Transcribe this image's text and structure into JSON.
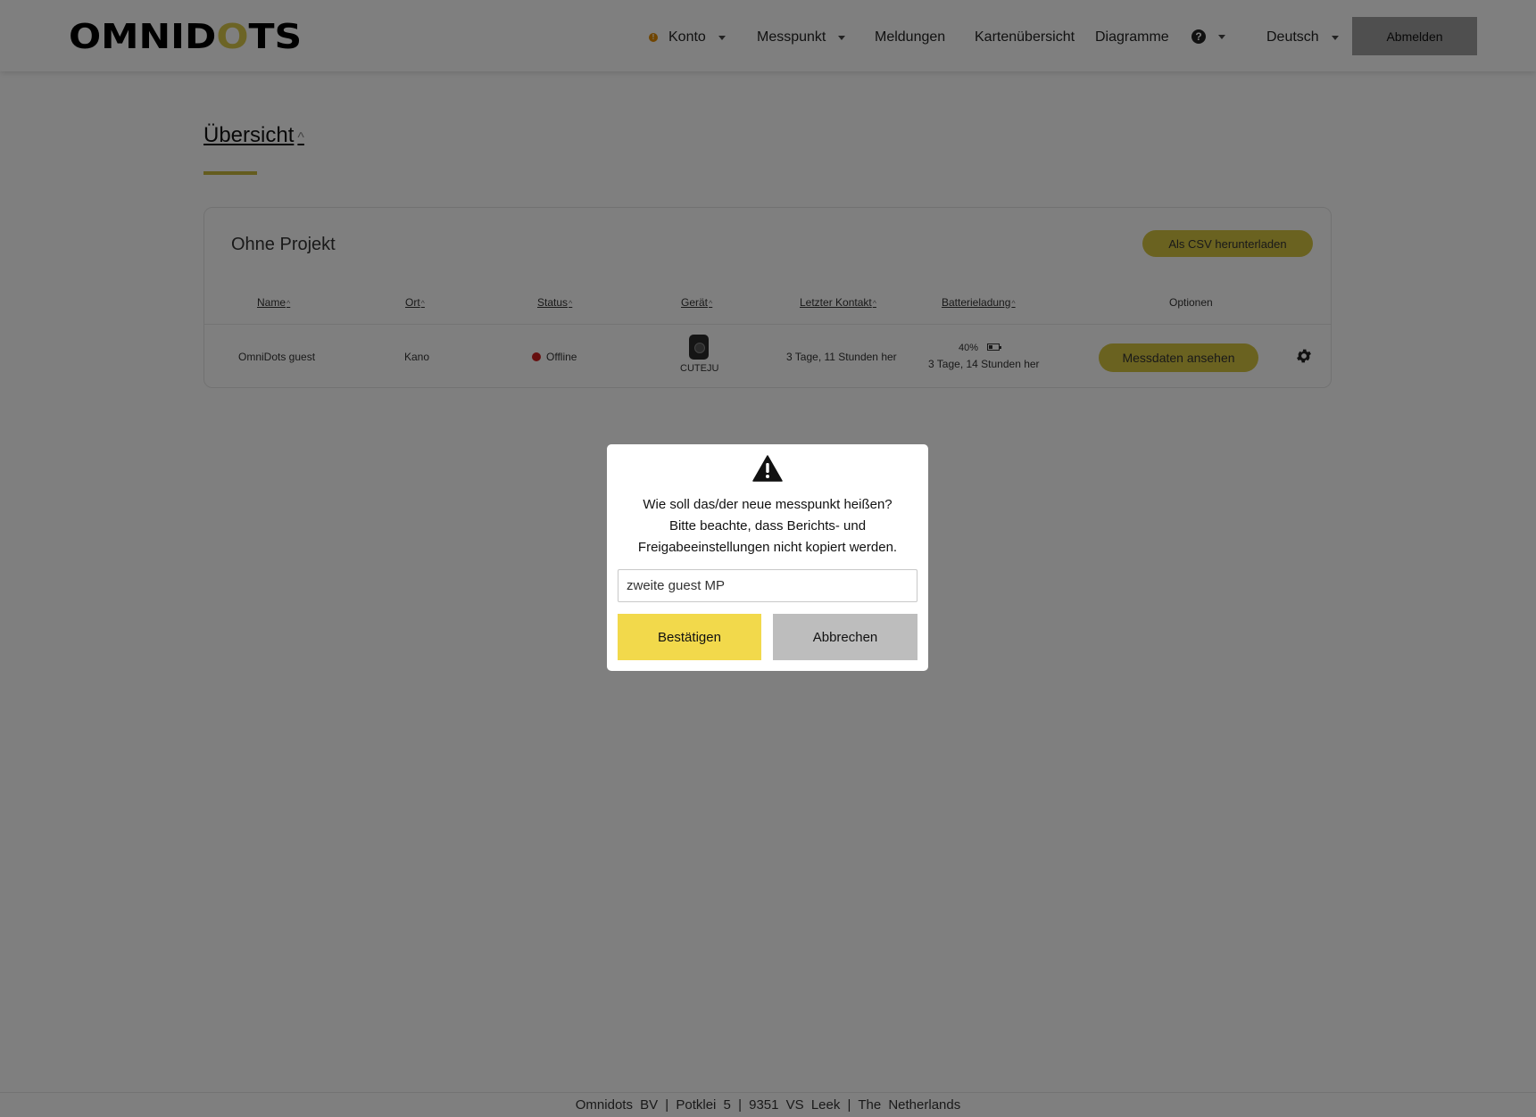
{
  "header": {
    "logo_left": "OMNID",
    "logo_accent": "O",
    "logo_right": "TS",
    "nav": {
      "konto": "Konto",
      "messpunkt": "Messpunkt",
      "meldungen": "Meldungen",
      "kartenuebersicht": "Kartenübersicht",
      "diagramme": "Diagramme",
      "help_glyph": "?",
      "language": "Deutsch"
    },
    "warning_glyph": "!",
    "logout_label": "Abmelden"
  },
  "page": {
    "title": "Übersicht",
    "sort_glyph": "^"
  },
  "card": {
    "title": "Ohne Projekt",
    "csv_button": "Als CSV herunterladen",
    "columns": {
      "name": "Name",
      "ort": "Ort",
      "status": "Status",
      "geraet": "Gerät",
      "letzter_kontakt": "Letzter Kontakt",
      "batterieladung": "Batterieladung",
      "optionen": "Optionen"
    },
    "row": {
      "name": "OmniDots guest",
      "ort": "Kano",
      "status": "Offline",
      "device": "CUTEJU",
      "last_contact": "3 Tage, 11 Stunden her",
      "battery_percent": "40%",
      "battery_time": "3 Tage, 14 Stunden her",
      "view_button": "Messdaten ansehen"
    }
  },
  "footer": {
    "text": "Omnidots BV | Potklei 5 | 9351 VS Leek | The Netherlands"
  },
  "modal": {
    "line1": "Wie soll das/der neue messpunkt heißen?",
    "line2": "Bitte beachte, dass Berichts- und",
    "line3": "Freigabeeinstellungen nicht kopiert werden.",
    "input_value": "zweite guest MP",
    "confirm_label": "Bestätigen",
    "cancel_label": "Abbrechen"
  },
  "colors": {
    "accent": "#d4c440",
    "confirm": "#f2d94b",
    "cancel": "#bdbdbd",
    "offline": "#cc1f1f"
  }
}
